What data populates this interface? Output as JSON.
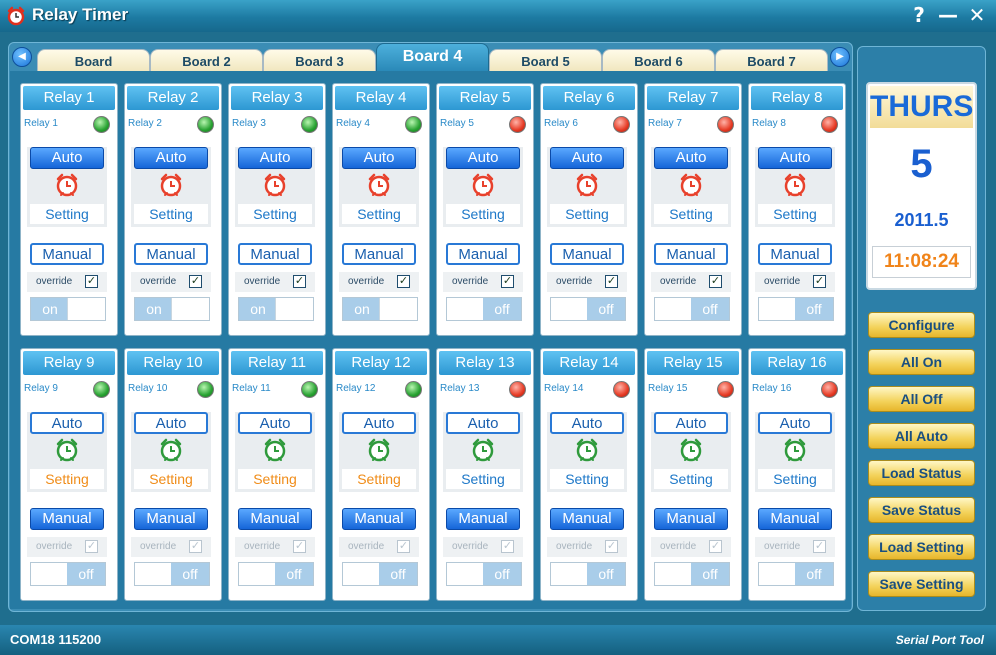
{
  "window": {
    "title": "Relay Timer",
    "help_symbol": "?",
    "minimize_symbol": "—",
    "close_symbol": "✕"
  },
  "tabs": [
    {
      "label": "Board",
      "active": false
    },
    {
      "label": "Board 2",
      "active": false
    },
    {
      "label": "Board 3",
      "active": false
    },
    {
      "label": "Board 4",
      "active": true
    },
    {
      "label": "Board 5",
      "active": false
    },
    {
      "label": "Board 6",
      "active": false
    },
    {
      "label": "Board 7",
      "active": false
    }
  ],
  "relays": [
    {
      "title": "Relay 1",
      "name": "Relay 1",
      "led": "green",
      "auto_style": "filled",
      "setting_color": "blue",
      "manual_style": "outline",
      "override_enabled": true,
      "toggle": "on",
      "alarm": "red"
    },
    {
      "title": "Relay 2",
      "name": "Relay 2",
      "led": "green",
      "auto_style": "filled",
      "setting_color": "blue",
      "manual_style": "outline",
      "override_enabled": true,
      "toggle": "on",
      "alarm": "red"
    },
    {
      "title": "Relay 3",
      "name": "Relay 3",
      "led": "green",
      "auto_style": "filled",
      "setting_color": "blue",
      "manual_style": "outline",
      "override_enabled": true,
      "toggle": "on",
      "alarm": "red"
    },
    {
      "title": "Relay 4",
      "name": "Relay 4",
      "led": "green",
      "auto_style": "filled",
      "setting_color": "blue",
      "manual_style": "outline",
      "override_enabled": true,
      "toggle": "on",
      "alarm": "red"
    },
    {
      "title": "Relay 5",
      "name": "Relay 5",
      "led": "red",
      "auto_style": "filled",
      "setting_color": "blue",
      "manual_style": "outline",
      "override_enabled": true,
      "toggle": "off",
      "alarm": "red"
    },
    {
      "title": "Relay 6",
      "name": "Relay 6",
      "led": "red",
      "auto_style": "filled",
      "setting_color": "blue",
      "manual_style": "outline",
      "override_enabled": true,
      "toggle": "off",
      "alarm": "red"
    },
    {
      "title": "Relay 7",
      "name": "Relay 7",
      "led": "red",
      "auto_style": "filled",
      "setting_color": "blue",
      "manual_style": "outline",
      "override_enabled": true,
      "toggle": "off",
      "alarm": "red"
    },
    {
      "title": "Relay 8",
      "name": "Relay 8",
      "led": "red",
      "auto_style": "filled",
      "setting_color": "blue",
      "manual_style": "outline",
      "override_enabled": true,
      "toggle": "off",
      "alarm": "red"
    },
    {
      "title": "Relay 9",
      "name": "Relay 9",
      "led": "green",
      "auto_style": "outline",
      "setting_color": "orange",
      "manual_style": "filled",
      "override_enabled": false,
      "toggle": "off",
      "alarm": "green"
    },
    {
      "title": "Relay 10",
      "name": "Relay 10",
      "led": "green",
      "auto_style": "outline",
      "setting_color": "orange",
      "manual_style": "filled",
      "override_enabled": false,
      "toggle": "off",
      "alarm": "green"
    },
    {
      "title": "Relay 11",
      "name": "Relay 11",
      "led": "green",
      "auto_style": "outline",
      "setting_color": "orange",
      "manual_style": "filled",
      "override_enabled": false,
      "toggle": "off",
      "alarm": "green"
    },
    {
      "title": "Relay 12",
      "name": "Relay 12",
      "led": "green",
      "auto_style": "outline",
      "setting_color": "orange",
      "manual_style": "filled",
      "override_enabled": false,
      "toggle": "off",
      "alarm": "green"
    },
    {
      "title": "Relay 13",
      "name": "Relay 13",
      "led": "red",
      "auto_style": "outline",
      "setting_color": "blue",
      "manual_style": "filled",
      "override_enabled": false,
      "toggle": "off",
      "alarm": "green"
    },
    {
      "title": "Relay 14",
      "name": "Relay 14",
      "led": "red",
      "auto_style": "outline",
      "setting_color": "blue",
      "manual_style": "filled",
      "override_enabled": false,
      "toggle": "off",
      "alarm": "green"
    },
    {
      "title": "Relay 15",
      "name": "Relay 15",
      "led": "red",
      "auto_style": "outline",
      "setting_color": "blue",
      "manual_style": "filled",
      "override_enabled": false,
      "toggle": "off",
      "alarm": "green"
    },
    {
      "title": "Relay 16",
      "name": "Relay 16",
      "led": "red",
      "auto_style": "outline",
      "setting_color": "blue",
      "manual_style": "filled",
      "override_enabled": false,
      "toggle": "off",
      "alarm": "green"
    }
  ],
  "labels": {
    "auto": "Auto",
    "setting": "Setting",
    "manual": "Manual",
    "override": "override",
    "on": "on",
    "off": "off",
    "check": "✓"
  },
  "clock": {
    "day": "THURS",
    "date": "5",
    "year_month": "2011.5",
    "time": "11:08:24"
  },
  "side_buttons": [
    {
      "label": "Configure"
    },
    {
      "label": "All On"
    },
    {
      "label": "All Off"
    },
    {
      "label": "All Auto"
    },
    {
      "label": "Load Status"
    },
    {
      "label": "Save Status"
    },
    {
      "label": "Load Setting"
    },
    {
      "label": "Save Setting"
    }
  ],
  "statusbar": {
    "connection": "COM18 115200",
    "brand": "Serial Port Tool"
  },
  "colors": {
    "led_green": "#28a232",
    "led_red": "#e63a24",
    "alarm_red": "#e8412c",
    "alarm_green": "#2f9a3c",
    "setting_orange": "#f08c18",
    "setting_blue": "#1e78c8"
  }
}
